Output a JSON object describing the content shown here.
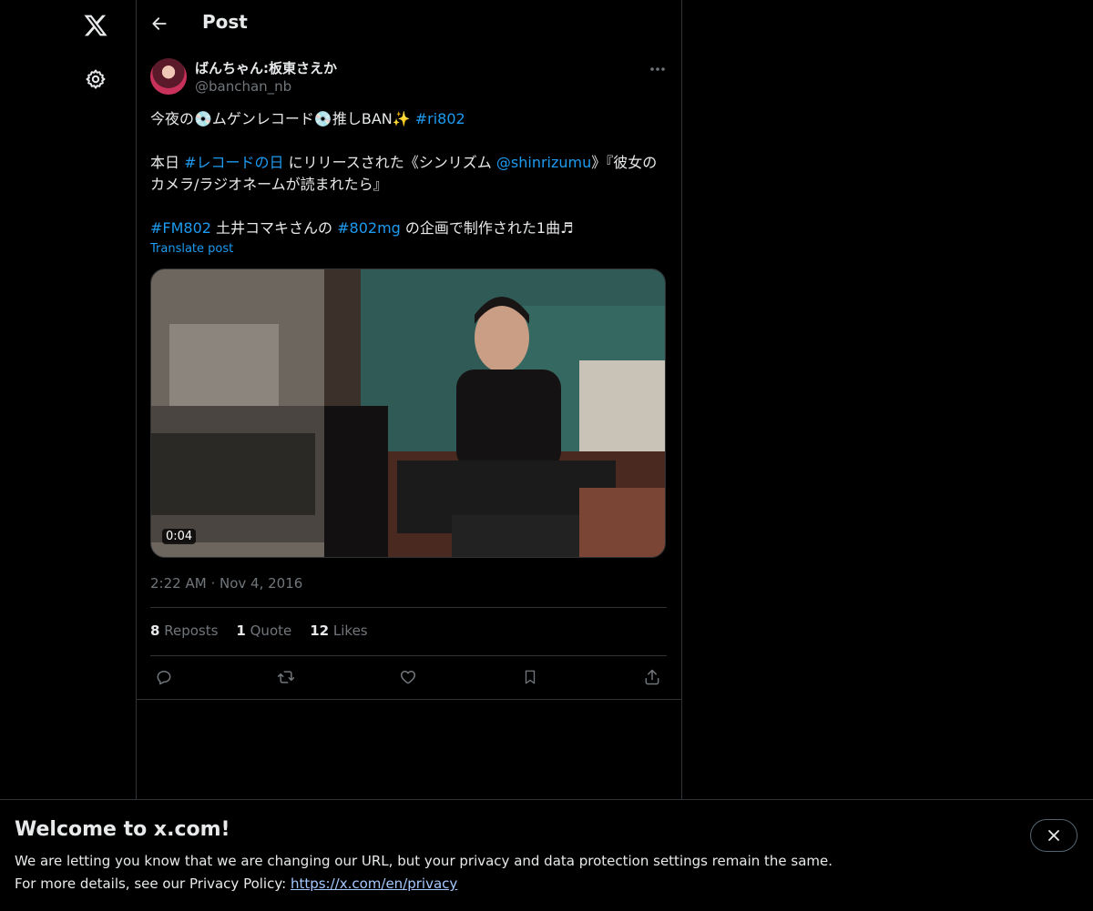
{
  "nav": {
    "logo_icon": "x-logo-icon",
    "settings_icon": "gear-icon"
  },
  "header": {
    "title": "Post",
    "back_icon": "arrow-left-icon"
  },
  "post": {
    "display_name": "ばんちゃん:板東さえか",
    "handle": "@banchan_nb",
    "text": {
      "p1_a": "今夜の💿ムゲンレコード💿推しBAN✨ ",
      "p1_tag": "#ri802",
      "p2_a": "本日 ",
      "p2_tag": "#レコードの日",
      "p2_b": " にリリースされた《シンリズム ",
      "p2_mention": "@shinrizumu",
      "p2_c": "》『彼女のカメラ/ラジオネームが読まれたら』",
      "p3_tag1": "#FM802",
      "p3_a": " 土井コマキさんの ",
      "p3_tag2": "#802mg",
      "p3_b": " の企画で制作された1曲♬"
    },
    "translate_label": "Translate post",
    "video_duration": "0:04",
    "time": "2:22 AM",
    "separator": "·",
    "date": "Nov 4, 2016",
    "stats": {
      "reposts_count": "8",
      "reposts_label": "Reposts",
      "quotes_count": "1",
      "quotes_label": "Quote",
      "likes_count": "12",
      "likes_label": "Likes"
    },
    "actions": [
      "reply-icon",
      "repost-icon",
      "like-icon",
      "bookmark-icon",
      "share-icon"
    ]
  },
  "banner": {
    "title": "Welcome to x.com!",
    "line1": "We are letting you know that we are changing our URL, but your privacy and data protection settings remain the same.",
    "line2_prefix": "For more details, see our Privacy Policy: ",
    "line2_link": "https://x.com/en/privacy"
  },
  "colors": {
    "background": "#000000",
    "text": "#e7e9ea",
    "muted": "#71767b",
    "link": "#1d9bf0",
    "border": "#2f3336"
  }
}
